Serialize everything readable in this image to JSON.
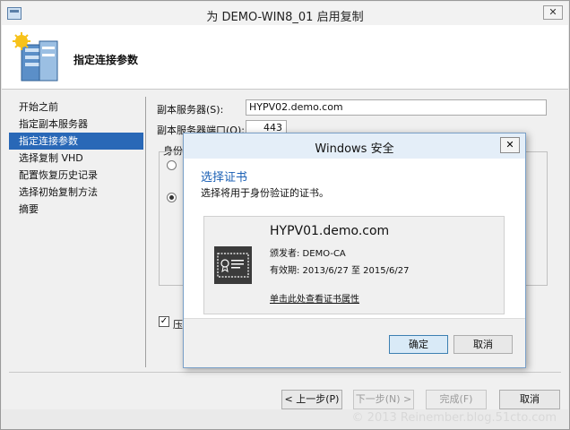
{
  "window": {
    "title": "为 DEMO-WIN8_01 启用复制",
    "close_glyph": "✕"
  },
  "header": {
    "title": "指定连接参数"
  },
  "nav": {
    "items": [
      {
        "label": "开始之前"
      },
      {
        "label": "指定副本服务器"
      },
      {
        "label": "指定连接参数"
      },
      {
        "label": "选择复制 VHD"
      },
      {
        "label": "配置恢复历史记录"
      },
      {
        "label": "选择初始复制方法"
      },
      {
        "label": "摘要"
      }
    ],
    "active_index": 2
  },
  "form": {
    "replica_server_label": "副本服务器(S):",
    "replica_server_value": "HYPV02.demo.com",
    "replica_port_label": "副本服务器端口(O):",
    "replica_port_value": "443",
    "auth_label_partial": "身份",
    "compress_label_partial": "压",
    "compress_checked": true
  },
  "footer": {
    "prev_label": "< 上一步(P)",
    "next_label": "下一步(N) >",
    "finish_label": "完成(F)",
    "cancel_label": "取消"
  },
  "dialog": {
    "title": "Windows 安全",
    "close_glyph": "✕",
    "heading": "选择证书",
    "subtitle": "选择将用于身份验证的证书。",
    "cert": {
      "name": "HYPV01.demo.com",
      "issuer": "颁发者: DEMO-CA",
      "validity": "有效期: 2013/6/27 至 2015/6/27",
      "link": "单击此处查看证书属性"
    },
    "ok_label": "确定",
    "cancel_label": "取消"
  },
  "watermark": "© 2013 Reinember.blog.51cto.com",
  "colors": {
    "accent": "#2968b7",
    "heading_blue": "#1a5fb4"
  }
}
